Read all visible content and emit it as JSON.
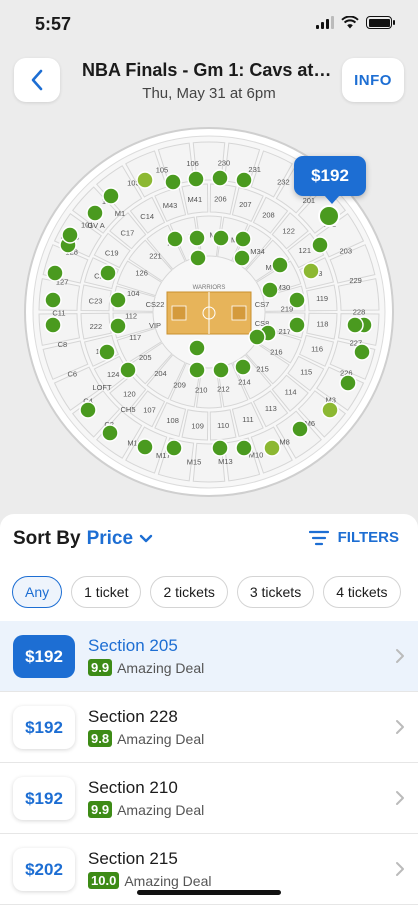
{
  "status": {
    "time": "5:57"
  },
  "header": {
    "title": "NBA Finals - Gm 1: Cavs at Warriors",
    "subtitle": "Thu, May 31 at 6pm",
    "info_label": "INFO"
  },
  "map": {
    "selected_price": "$192",
    "court_label": "WARRIORS",
    "side_labels": [
      "GV B",
      "GV A",
      "M1",
      "LOFT",
      "CH5",
      "VIP",
      "CS22",
      "CS7",
      "CS8"
    ],
    "sections": [
      "230",
      "231",
      "232",
      "201",
      "202",
      "203",
      "229",
      "228",
      "227",
      "226",
      "M3",
      "M6",
      "M8",
      "M10",
      "M13",
      "M15",
      "M17",
      "M19",
      "C2",
      "C4",
      "C6",
      "C8",
      "C11",
      "127",
      "128",
      "101",
      "102",
      "103",
      "105",
      "106",
      "206",
      "207",
      "208",
      "122",
      "121",
      "123",
      "119",
      "118",
      "116",
      "115",
      "114",
      "113",
      "111",
      "110",
      "109",
      "108",
      "107",
      "120",
      "124",
      "125",
      "222",
      "C23",
      "C21",
      "C19",
      "C17",
      "C14",
      "M43",
      "M41",
      "M39",
      "M36",
      "M34",
      "M32",
      "M30",
      "219",
      "217",
      "216",
      "215",
      "214",
      "212",
      "210",
      "209",
      "204",
      "205",
      "117",
      "112",
      "104",
      "126",
      "221",
      "220",
      "223",
      "224",
      "225",
      "211",
      "213",
      "218"
    ],
    "colors": {
      "dot_green": "#4a9a1f",
      "dot_light": "#8cb832",
      "court": "#e7b45a",
      "section_fill": "#f4f4f4",
      "accent": "#1d6ed3"
    }
  },
  "sheet": {
    "sort_label": "Sort By",
    "sort_value": "Price",
    "filters_label": "FILTERS",
    "chips": [
      "Any",
      "1 ticket",
      "2 tickets",
      "3 tickets",
      "4 tickets"
    ],
    "listings": [
      {
        "price": "$192",
        "section": "Section 205",
        "score": "9.9",
        "deal": "Amazing Deal"
      },
      {
        "price": "$192",
        "section": "Section 228",
        "score": "9.8",
        "deal": "Amazing Deal"
      },
      {
        "price": "$192",
        "section": "Section 210",
        "score": "9.9",
        "deal": "Amazing Deal"
      },
      {
        "price": "$202",
        "section": "Section 215",
        "score": "10.0",
        "deal": "Amazing Deal"
      }
    ]
  }
}
